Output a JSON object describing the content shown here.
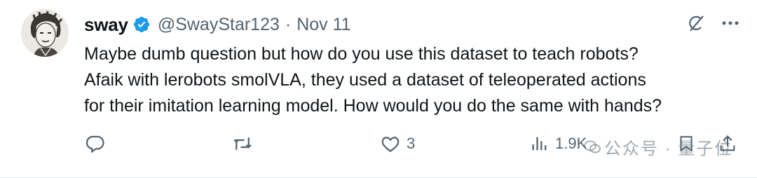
{
  "author": {
    "name": "sway",
    "handle": "@SwayStar123",
    "separator": "·",
    "date": "Nov 11"
  },
  "tweet": {
    "lines": [
      "Maybe dumb question but how do you use this dataset to teach robots?",
      "Afaik with lerobots smolVLA, they used a dataset of teleoperated actions",
      "for their imitation learning model. How would you do the same with hands?"
    ]
  },
  "metrics": {
    "replies": "",
    "retweets": "",
    "likes": "3",
    "views": "1.9K"
  },
  "watermark": {
    "text": "公众号 · 量子位"
  },
  "colors": {
    "verified": "#1d9bf0",
    "muted": "#536471",
    "text": "#0f1419"
  },
  "icons": {
    "verified": "verified-badge-icon",
    "grok": "grok-icon",
    "more": "more-icon",
    "reply": "reply-icon",
    "retweet": "retweet-icon",
    "like": "like-icon",
    "views": "views-icon",
    "bookmark": "bookmark-icon",
    "share": "share-icon"
  }
}
